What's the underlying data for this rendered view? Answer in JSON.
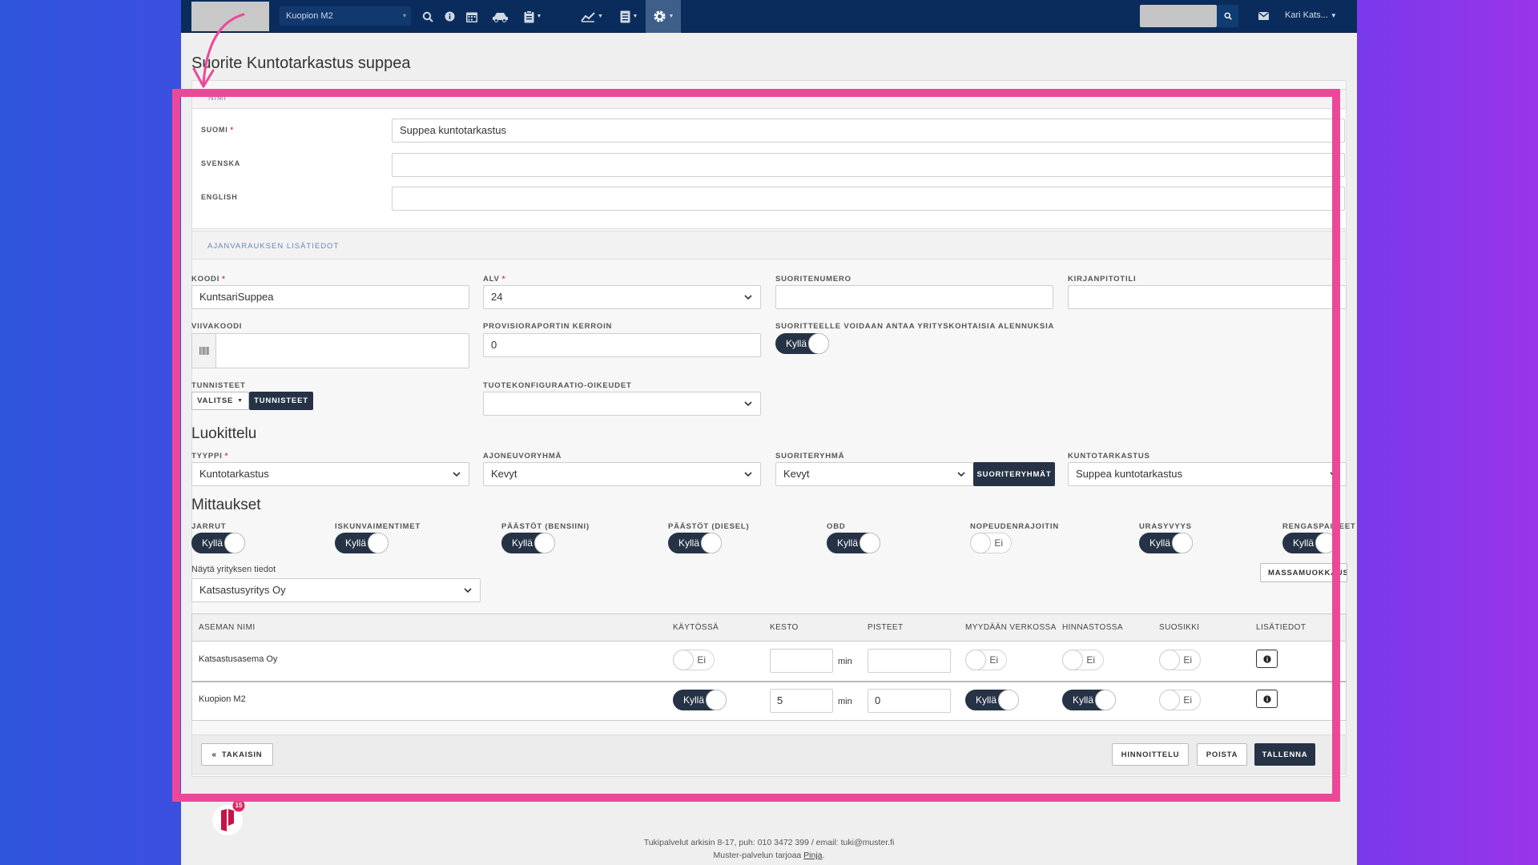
{
  "topnav": {
    "location": "Kuopion M2",
    "user": "Kari Kats...",
    "icons": [
      "search-icon",
      "info-icon",
      "calendar-icon",
      "car-icon",
      "clipboard-icon",
      "chart-icon",
      "document-icon",
      "gear-icon"
    ]
  },
  "page": {
    "title": "Suorite Kuntotarkastus suppea"
  },
  "name_panel": {
    "header": "NIMI",
    "suomi_label": "SUOMI",
    "suomi_value": "Suppea kuntotarkastus",
    "svenska_label": "SVENSKA",
    "svenska_value": "",
    "english_label": "ENGLISH",
    "english_value": ""
  },
  "booking_panel": {
    "label": "AJANVARAUKSEN LISÄTIEDOT"
  },
  "fields": {
    "koodi_label": "KOODI",
    "koodi_value": "KuntsariSuppea",
    "alv_label": "ALV",
    "alv_value": "24",
    "suoritenumero_label": "SUORITENUMERO",
    "suoritenumero_value": "",
    "kirjanpitotili_label": "KIRJANPITOTILI",
    "kirjanpitotili_value": "",
    "viivakoodi_label": "VIIVAKOODI",
    "viivakoodi_value": "",
    "provisio_label": "PROVISIORAPORTIN KERROIN",
    "provisio_value": "0",
    "alennus_label": "SUORITTEELLE VOIDAAN ANTAA YRITYSKOHTAISIA ALENNUKSIA",
    "alennus_toggle": "Kyllä",
    "tunnisteet_label": "TUNNISTEET",
    "valitse_button": "VALITSE",
    "tunnisteet_button": "TUNNISTEET",
    "tuotekonfig_label": "TUOTEKONFIGURAATIO-OIKEUDET",
    "tuotekonfig_value": ""
  },
  "luokittelu": {
    "heading": "Luokittelu",
    "tyyppi_label": "TYYPPI",
    "tyyppi_value": "Kuntotarkastus",
    "ajoneuvoryhma_label": "AJONEUVORYHMÄ",
    "ajoneuvoryhma_value": "Kevyt",
    "suoriteryhma_label": "SUORITERYHMÄ",
    "suoriteryhma_value": "Kevyt",
    "suoriteryhmat_button": "SUORITERYHMÄT",
    "kuntotarkastus_label": "KUNTOTARKASTUS",
    "kuntotarkastus_value": "Suppea kuntotarkastus"
  },
  "mittaukset": {
    "heading": "Mittaukset",
    "items": [
      {
        "label": "JARRUT",
        "state": "Kyllä"
      },
      {
        "label": "ISKUNVAIMENTIMET",
        "state": "Kyllä"
      },
      {
        "label": "PÄÄSTÖT (BENSIINI)",
        "state": "Kyllä"
      },
      {
        "label": "PÄÄSTÖT (DIESEL)",
        "state": "Kyllä"
      },
      {
        "label": "OBD",
        "state": "Kyllä"
      },
      {
        "label": "NOPEUDENRAJOITIN",
        "state": "Ei"
      },
      {
        "label": "URASYVYYS",
        "state": "Kyllä"
      },
      {
        "label": "RENGASPAINEET",
        "state": "Kyllä"
      }
    ],
    "company_label": "Näytä yrityksen tiedot",
    "company_value": "Katsastusyritys Oy",
    "massamuokkaus_button": "MASSAMUOKKAUS"
  },
  "table": {
    "headers": [
      "ASEMAN NIMI",
      "KÄYTÖSSÄ",
      "KESTO",
      "PISTEET",
      "MYYDÄÄN VERKOSSA",
      "HINNASTOSSA",
      "SUOSIKKI",
      "LISÄTIEDOT"
    ],
    "unit": "min",
    "rows": [
      {
        "name": "Katsastusasema Oy",
        "kaytossa": "Ei",
        "kesto": "",
        "pisteet": "",
        "verkossa": "Ei",
        "hinnastossa": "Ei",
        "suosikki": "Ei"
      },
      {
        "name": "Kuopion M2",
        "kaytossa": "Kyllä",
        "kesto": "5",
        "pisteet": "0",
        "verkossa": "Kyllä",
        "hinnastossa": "Kyllä",
        "suosikki": "Ei"
      }
    ]
  },
  "footer_buttons": {
    "back": "TAKAISIN",
    "pricing": "HINNOITTELU",
    "delete": "POISTA",
    "save": "TALLENNA"
  },
  "site_footer": {
    "support": "Tukipalvelut arkisin 8-17, puh: 010 3472 399 / email: tuki@muster.fi",
    "provided_prefix": "Muster-palvelun tarjoaa ",
    "provider": "Pinja",
    "provided_suffix": ".",
    "badge_count": "15"
  },
  "colors": {
    "nav": "#0a2c5c",
    "toggle_on": "#263346",
    "highlight": "#ec4899"
  }
}
